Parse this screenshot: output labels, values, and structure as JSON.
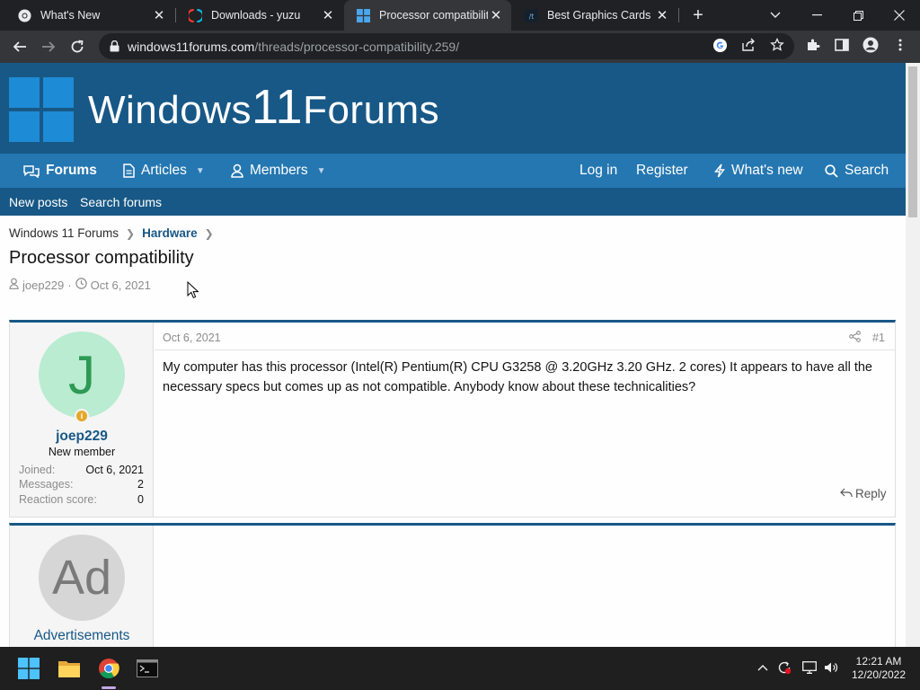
{
  "browser": {
    "tabs": [
      {
        "title": "What's New",
        "icon": "chrome-icon"
      },
      {
        "title": "Downloads - yuzu",
        "icon": "yuzu-icon"
      },
      {
        "title": "Processor compatibility",
        "icon": "windows-icon"
      },
      {
        "title": "Best Graphics Cards Un",
        "icon": "tomshardware-icon"
      }
    ],
    "new_tab_label": "+",
    "url_host": "windows11forums.com",
    "url_path": "/threads/processor-compatibility.259/"
  },
  "site": {
    "logo_prefix": "Windows",
    "logo_number": "11",
    "logo_suffix": "Forums",
    "nav": {
      "forums": "Forums",
      "articles": "Articles",
      "members": "Members",
      "login": "Log in",
      "register": "Register",
      "whats_new": "What's new",
      "search": "Search"
    },
    "subnav": {
      "new_posts": "New posts",
      "search_forums": "Search forums"
    },
    "colors": {
      "header": "#185886",
      "nav": "#2577b1",
      "avatar_user_bg": "#b9ecd0",
      "avatar_user_fg": "#2e9a55",
      "avatar_ad_bg": "#d6d6d6",
      "avatar_ad_fg": "#7a7a7a"
    }
  },
  "thread": {
    "breadcrumb": [
      "Windows 11 Forums",
      "Hardware"
    ],
    "title": "Processor compatibility",
    "author": "joep229",
    "date": "Oct 6, 2021"
  },
  "post": {
    "avatar_letter": "J",
    "username": "joep229",
    "user_title": "New member",
    "stats": [
      {
        "label": "Joined:",
        "value": "Oct 6, 2021"
      },
      {
        "label": "Messages:",
        "value": "2"
      },
      {
        "label": "Reaction score:",
        "value": "0"
      }
    ],
    "date": "Oct 6, 2021",
    "number": "#1",
    "body": "My computer has this processor (Intel(R) Pentium(R) CPU G3258 @ 3.20GHz 3.20 GHz. 2 cores) It appears to have all the necessary specs but comes up as not compatible. Anybody know about these technicalities?",
    "reply_label": "Reply"
  },
  "ad": {
    "avatar_text": "Ad",
    "name": "Advertisements"
  },
  "taskbar": {
    "apps": [
      "start-icon",
      "file-explorer-icon",
      "chrome-icon",
      "terminal-icon"
    ],
    "time": "12:21 AM",
    "date": "12/20/2022"
  }
}
